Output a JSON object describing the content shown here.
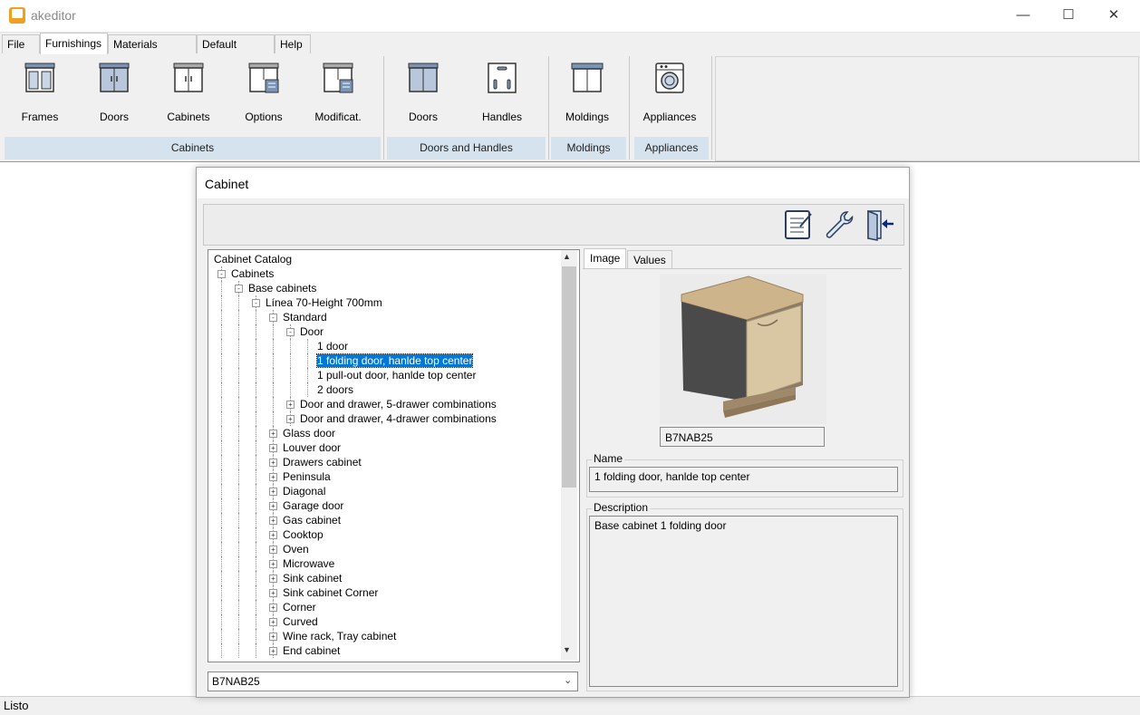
{
  "window": {
    "title": "akeditor",
    "controls": [
      "minimize-icon",
      "maximize-icon",
      "close-icon"
    ]
  },
  "menu": {
    "tabs": [
      "File",
      "Furnishings",
      "Materials _Series",
      "Default values",
      "Help"
    ],
    "active": "Furnishings"
  },
  "ribbon": {
    "groups": [
      {
        "label": "Cabinets",
        "buttons": [
          "Frames",
          "Doors",
          "Cabinets",
          "Options",
          "Modificat."
        ]
      },
      {
        "label": "Doors and Handles",
        "buttons": [
          "Doors",
          "Handles"
        ]
      },
      {
        "label": "Moldings",
        "buttons": [
          "Moldings"
        ]
      },
      {
        "label": "Appliances",
        "buttons": [
          "Appliances"
        ]
      }
    ]
  },
  "dialog": {
    "title": "Cabinet",
    "toolbar_icons": [
      "report-icon",
      "wrench-icon",
      "exit-door-icon"
    ],
    "tree": [
      {
        "text": "Cabinet Catalog",
        "level": 0,
        "box": ""
      },
      {
        "text": "Cabinets",
        "level": 1,
        "box": "-"
      },
      {
        "text": "Base cabinets",
        "level": 2,
        "box": "-"
      },
      {
        "text": "Línea 70-Height 700mm",
        "level": 3,
        "box": "-"
      },
      {
        "text": "Standard",
        "level": 4,
        "box": "-"
      },
      {
        "text": "Door",
        "level": 5,
        "box": "-"
      },
      {
        "text": "1 door",
        "level": 6,
        "box": ""
      },
      {
        "text": "1 folding door, hanlde top center",
        "level": 6,
        "box": "",
        "selected": true
      },
      {
        "text": "1 pull-out door, hanlde top center",
        "level": 6,
        "box": ""
      },
      {
        "text": "2 doors",
        "level": 6,
        "box": ""
      },
      {
        "text": "Door and drawer, 5-drawer combinations",
        "level": 5,
        "box": "+"
      },
      {
        "text": "Door and drawer, 4-drawer combinations",
        "level": 5,
        "box": "+"
      },
      {
        "text": "Glass door",
        "level": 4,
        "box": "+"
      },
      {
        "text": "Louver door",
        "level": 4,
        "box": "+"
      },
      {
        "text": "Drawers cabinet",
        "level": 4,
        "box": "+"
      },
      {
        "text": "Peninsula",
        "level": 4,
        "box": "+"
      },
      {
        "text": "Diagonal",
        "level": 4,
        "box": "+"
      },
      {
        "text": "Garage door",
        "level": 4,
        "box": "+"
      },
      {
        "text": "Gas cabinet",
        "level": 4,
        "box": "+"
      },
      {
        "text": "Cooktop",
        "level": 4,
        "box": "+"
      },
      {
        "text": "Oven",
        "level": 4,
        "box": "+"
      },
      {
        "text": "Microwave",
        "level": 4,
        "box": "+"
      },
      {
        "text": "Sink cabinet",
        "level": 4,
        "box": "+"
      },
      {
        "text": "Sink cabinet Corner",
        "level": 4,
        "box": "+"
      },
      {
        "text": "Corner",
        "level": 4,
        "box": "+"
      },
      {
        "text": "Curved",
        "level": 4,
        "box": "+"
      },
      {
        "text": "Wine rack, Tray cabinet",
        "level": 4,
        "box": "+"
      },
      {
        "text": "End cabinet",
        "level": 4,
        "box": "+"
      }
    ],
    "combo_value": "B7NAB25",
    "tabs": [
      "Image",
      "Values"
    ],
    "active_tab": "Image",
    "image_code": "B7NAB25",
    "name_label": "Name",
    "name_value": "1 folding door, hanlde top center",
    "description_label": "Description",
    "description_value": "Base cabinet 1 folding door"
  },
  "status": {
    "text": "Listo"
  },
  "colors": {
    "ribbon_group_bg": "#d4e3ee",
    "selection": "#0078d7",
    "cabinet_panel": "#d9c7a4",
    "cabinet_side": "#4a4a4a"
  }
}
